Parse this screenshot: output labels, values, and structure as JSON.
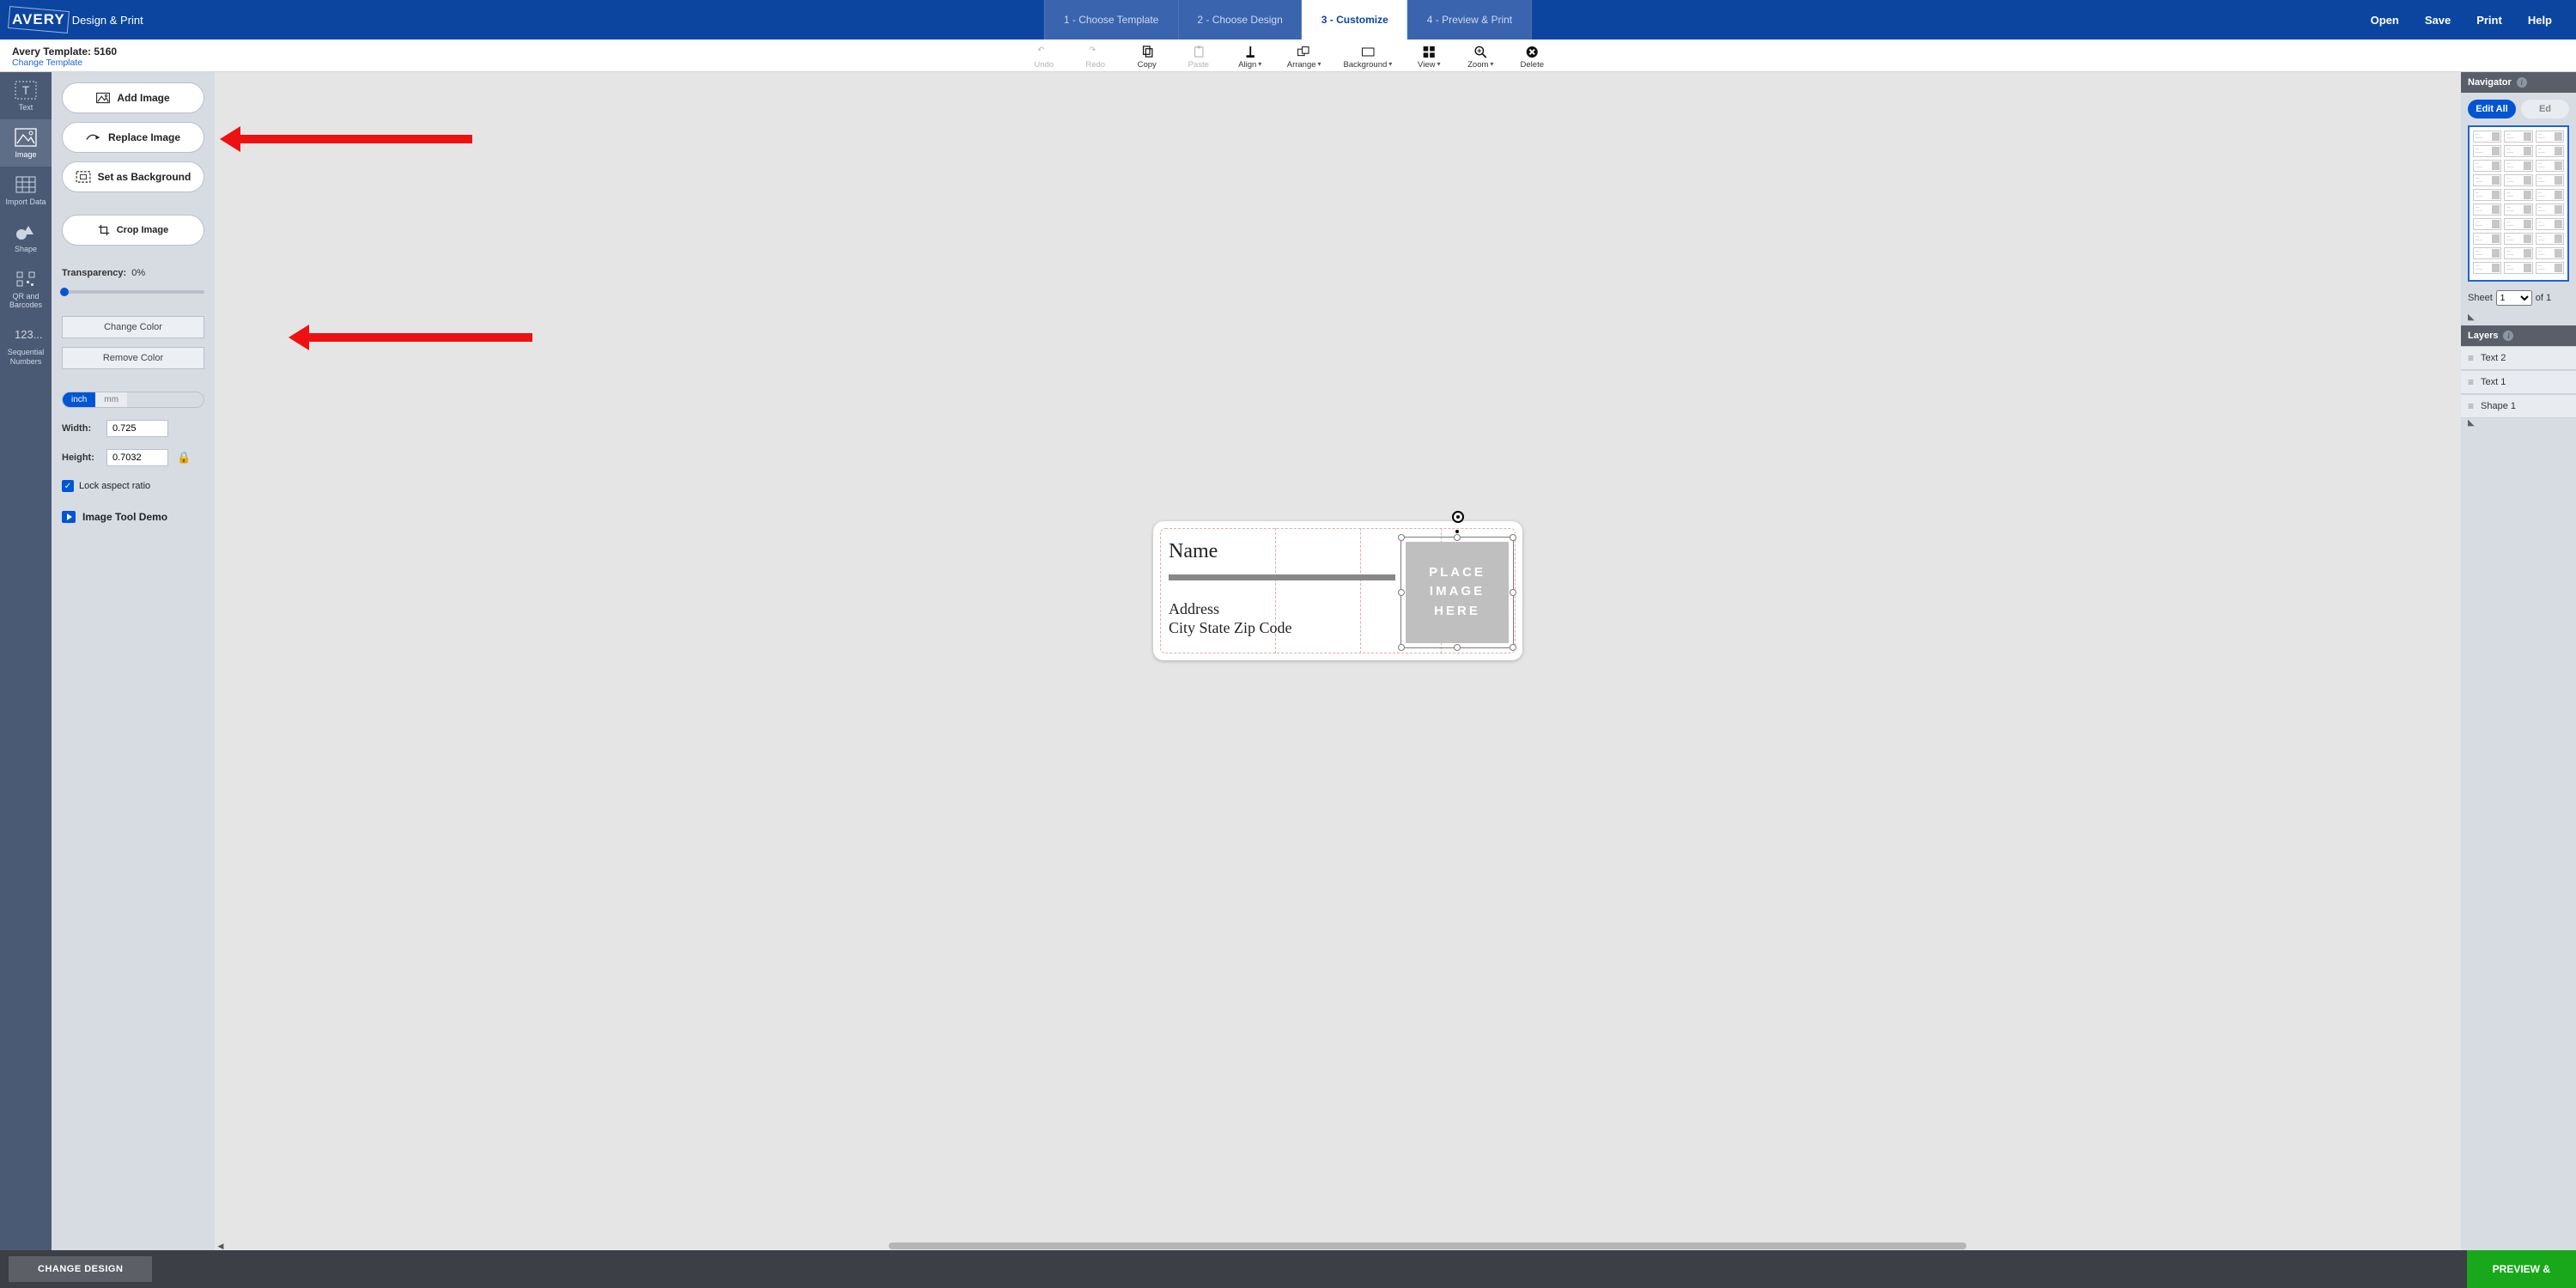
{
  "brand": {
    "logo": "AVERY",
    "product": "Design & Print"
  },
  "steps": [
    {
      "label": "1 - Choose Template",
      "state": "dim"
    },
    {
      "label": "2 - Choose Design",
      "state": "dim"
    },
    {
      "label": "3 - Customize",
      "state": "active"
    },
    {
      "label": "4 - Preview & Print",
      "state": "dim"
    }
  ],
  "top_actions": {
    "open": "Open",
    "save": "Save",
    "print": "Print",
    "help": "Help"
  },
  "subheader": {
    "template_title": "Avery Template: 5160",
    "change_link": "Change Template"
  },
  "tools": {
    "undo": "Undo",
    "redo": "Redo",
    "copy": "Copy",
    "paste": "Paste",
    "align": "Align",
    "arrange": "Arrange",
    "background": "Background",
    "view": "View",
    "zoom": "Zoom",
    "delete": "Delete"
  },
  "vnav": {
    "text": "Text",
    "image": "Image",
    "import": "Import Data",
    "shape": "Shape",
    "qr": "QR and Barcodes",
    "seq": "Sequential Numbers",
    "seq_icon": "123..."
  },
  "panel": {
    "add_image": "Add Image",
    "replace_image": "Replace Image",
    "set_bg": "Set as Background",
    "crop": "Crop Image",
    "transparency_label": "Transparency:",
    "transparency_value": "0%",
    "change_color": "Change Color",
    "remove_color": "Remove Color",
    "unit_inch": "inch",
    "unit_mm": "mm",
    "width_label": "Width:",
    "width_value": "0.725",
    "height_label": "Height:",
    "height_value": "0.7032",
    "lock_aspect": "Lock aspect ratio",
    "demo": "Image Tool Demo"
  },
  "canvas": {
    "name": "Name",
    "address": "Address",
    "csz": "City State Zip Code",
    "placeholder1": "PLACE",
    "placeholder2": "IMAGE",
    "placeholder3": "HERE"
  },
  "navigator": {
    "title": "Navigator",
    "edit_all": "Edit All",
    "edit_one": "Ed",
    "sheet_label": "Sheet",
    "sheet_value": "1",
    "sheet_of": "of 1"
  },
  "layers": {
    "title": "Layers",
    "items": [
      "Text 2",
      "Text 1",
      "Shape 1"
    ]
  },
  "footer": {
    "change_design": "CHANGE DESIGN",
    "preview": "PREVIEW &"
  }
}
